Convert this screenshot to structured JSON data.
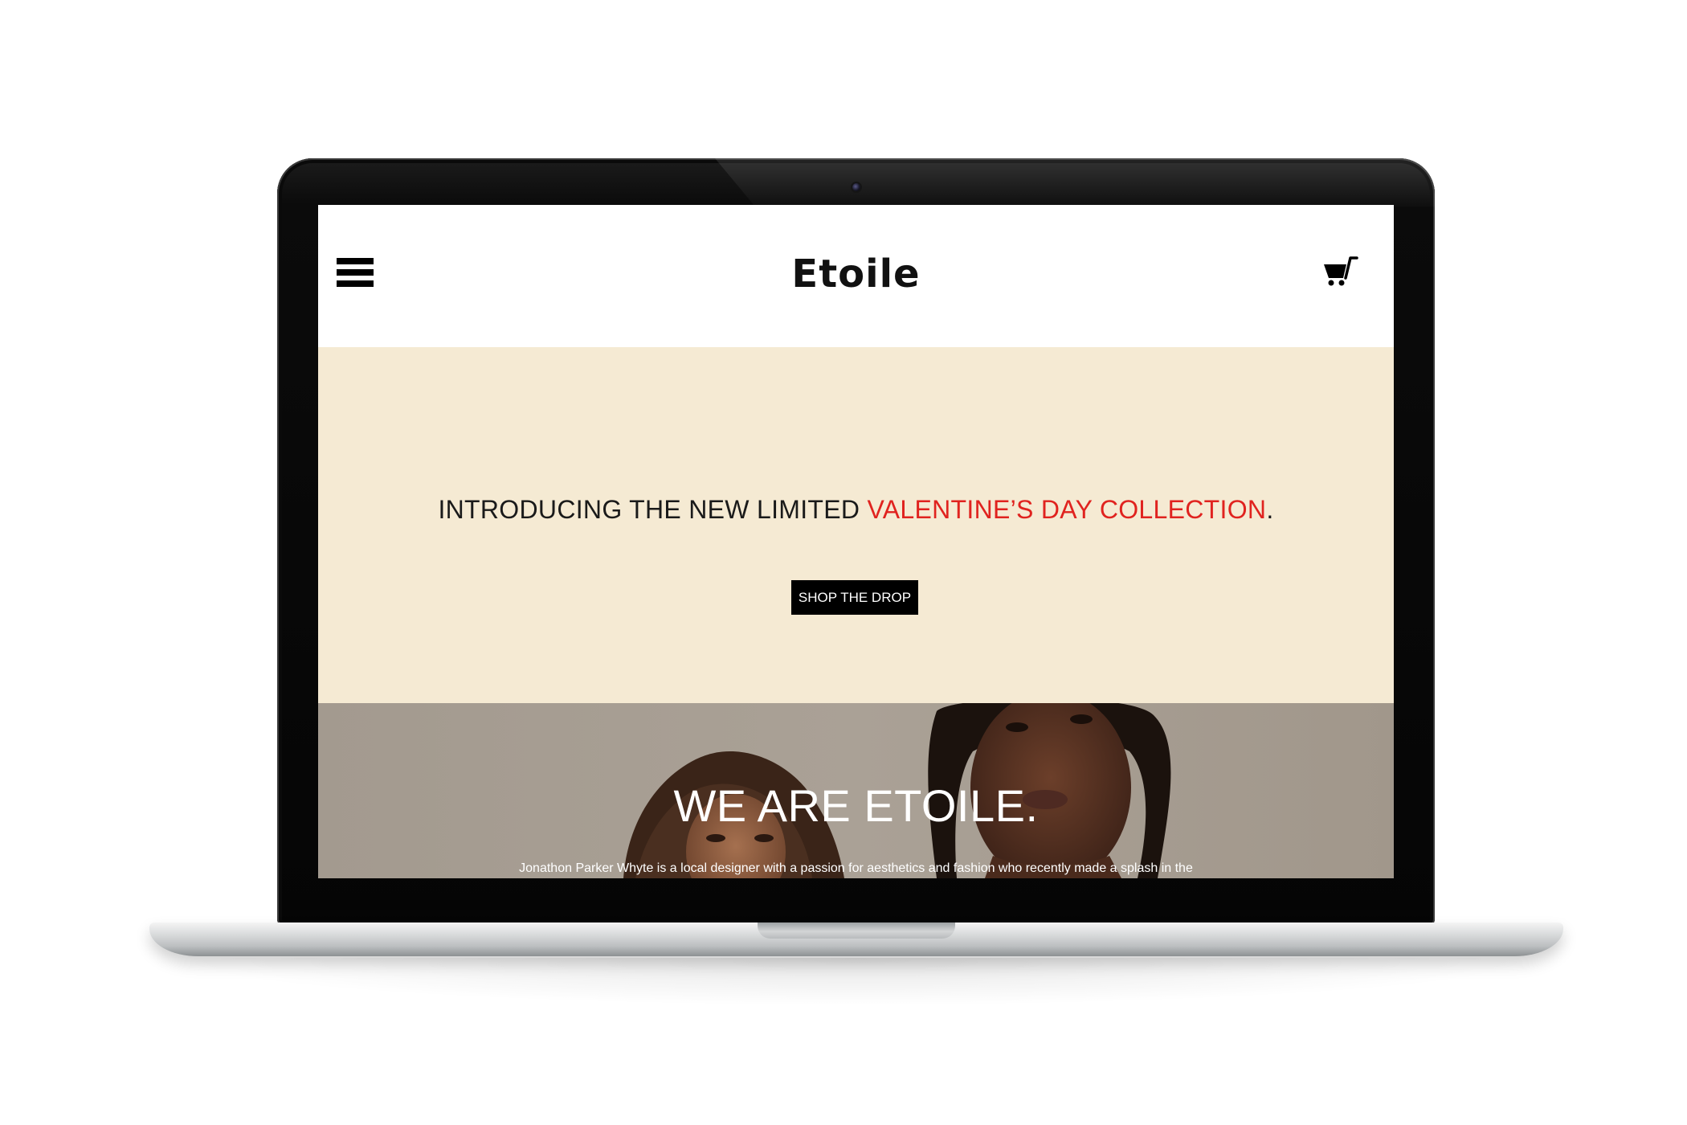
{
  "site": {
    "brand": "Etoile",
    "menu_icon": "hamburger-menu-icon",
    "cart_icon": "shopping-cart-icon"
  },
  "hero": {
    "headline_prefix": "INTRODUCING THE NEW LIMITED ",
    "headline_accent": "VALENTINE’S DAY COLLECTION",
    "headline_suffix": ".",
    "cta_label": "SHOP THE DROP",
    "background_color": "#f5ead3",
    "accent_color": "#e0231f"
  },
  "about": {
    "title": "WE ARE ETOILE.",
    "text": "Jonathon Parker Whyte is a local designer with a passion for aesthetics and fashion who recently made a splash in the"
  }
}
